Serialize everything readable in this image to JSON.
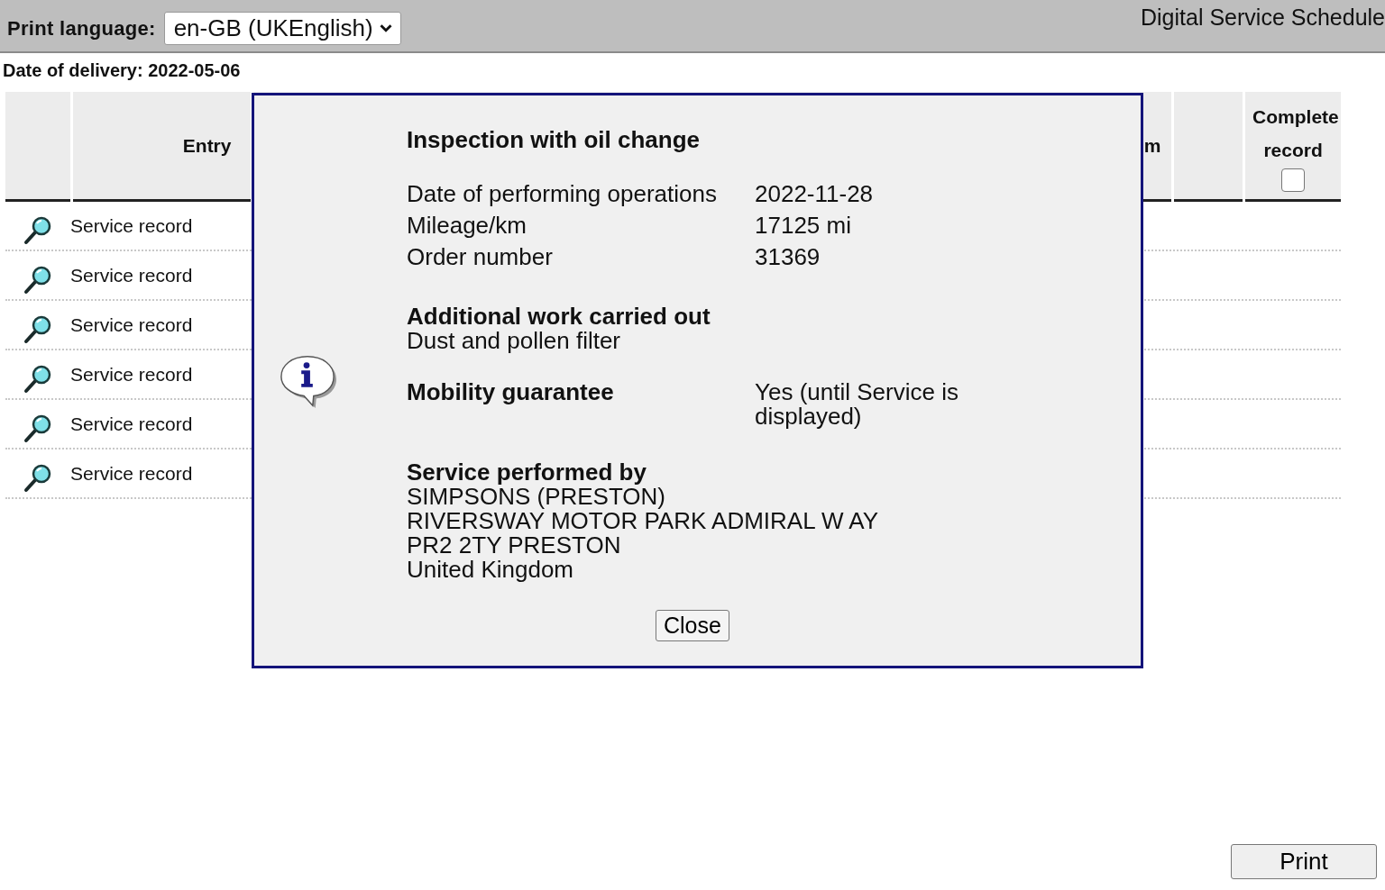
{
  "toolbar": {
    "language_label": "Print language:",
    "language_value": "en-GB (UKEnglish)",
    "title": "Digital Service Schedule"
  },
  "delivery": "Date of delivery: 2022-05-06",
  "table": {
    "columns": [
      {
        "kind": "icon"
      },
      {
        "kind": "text",
        "label": "Entry"
      },
      {
        "kind": "text",
        "label": "m"
      },
      {
        "kind": "blank"
      },
      {
        "kind": "check",
        "label": "Complete record",
        "checked": false
      }
    ],
    "rows": [
      {
        "entry": "Service record"
      },
      {
        "entry": "Service record"
      },
      {
        "entry": "Service record"
      },
      {
        "entry": "Service record"
      },
      {
        "entry": "Service record"
      },
      {
        "entry": "Service record"
      }
    ]
  },
  "dialog": {
    "title": "Inspection with oil change",
    "details": [
      {
        "label": "Date of performing operations",
        "value": "2022-11-28"
      },
      {
        "label": "Mileage/km",
        "value": "17125 mi"
      },
      {
        "label": "Order number",
        "value": "31369"
      }
    ],
    "additional": {
      "heading": "Additional work carried out",
      "text": "Dust and pollen filter"
    },
    "mobility": {
      "label": "Mobility guarantee",
      "value": "Yes (until Service is displayed)"
    },
    "performed_by": {
      "heading": "Service performed by",
      "lines": [
        "SIMPSONS (PRESTON)",
        "RIVERSWAY MOTOR PARK ADMIRAL W AY",
        "PR2 2TY PRESTON",
        "United Kingdom"
      ]
    },
    "close": "Close"
  },
  "print": "Print"
}
